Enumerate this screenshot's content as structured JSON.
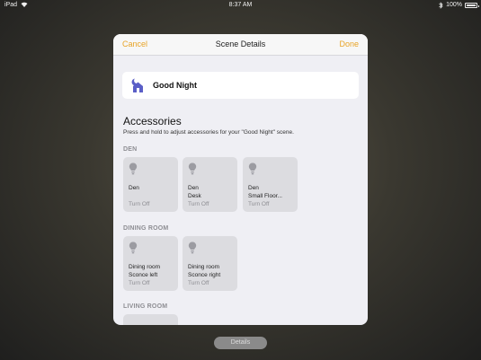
{
  "status_bar": {
    "device": "iPad",
    "time": "8:37 AM",
    "battery": "100%",
    "battery_level": 1.0
  },
  "nav": {
    "cancel": "Cancel",
    "title": "Scene Details",
    "done": "Done"
  },
  "scene": {
    "name": "Good Night",
    "icon": "moon-house-icon"
  },
  "accessories": {
    "heading": "Accessories",
    "description": "Press and hold to adjust accessories for your \"Good Night\" scene."
  },
  "rooms": {
    "den": {
      "label": "DEN",
      "tiles": [
        {
          "line1": "Den",
          "line2": "",
          "state": "Turn Off"
        },
        {
          "line1": "Den",
          "line2": "Desk",
          "state": "Turn Off"
        },
        {
          "line1": "Den",
          "line2": "Small Floor...",
          "state": "Turn Off"
        }
      ]
    },
    "dining": {
      "label": "DINING ROOM",
      "tiles": [
        {
          "line1": "Dining room",
          "line2": "Sconce left",
          "state": "Turn Off"
        },
        {
          "line1": "Dining room",
          "line2": "Sconce right",
          "state": "Turn Off"
        }
      ]
    },
    "living": {
      "label": "LIVING ROOM"
    }
  },
  "footer": {
    "details_button": "Details"
  },
  "colors": {
    "accent": "#e8a427",
    "scene_icon": "#5b5fc7"
  }
}
